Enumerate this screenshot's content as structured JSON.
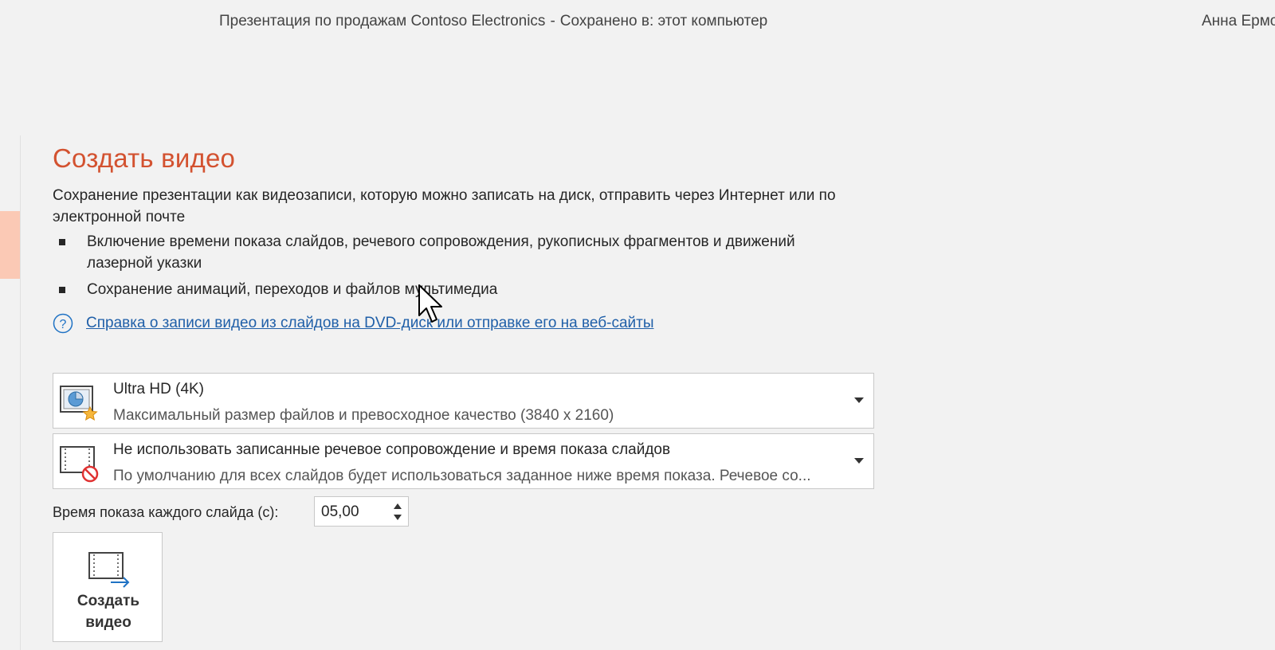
{
  "window": {
    "doc_name": "Презентация по продажам Contoso Electronics",
    "separator": "-",
    "save_status": "Сохранено в: этот компьютер",
    "user_name": "Анна Ермо"
  },
  "main": {
    "heading": "Создать видео",
    "description": "Сохранение презентации как видеозаписи, которую можно записать на диск, отправить через Интернет или по электронной почте",
    "bullets": [
      "Включение времени показа слайдов, речевого сопровождения, рукописных фрагментов и движений лазерной указки",
      "Сохранение анимаций, переходов и файлов мультимедиа"
    ],
    "help_link": "Справка о записи видео из слайдов на DVD-диск или отправке его на веб-сайты"
  },
  "quality_dropdown": {
    "title": "Ultra HD (4K)",
    "subtitle": "Максимальный размер файлов и превосходное качество (3840 x 2160)",
    "icon": "presentation-quality-star-icon"
  },
  "narration_dropdown": {
    "title": "Не использовать записанные речевое сопровождение и время показа слайдов",
    "subtitle": "По умолчанию для всех слайдов будет использоваться заданное ниже время показа. Речевое со...",
    "icon": "filmstrip-no-icon"
  },
  "slide_time": {
    "label": "Время показа каждого слайда (с):",
    "value": "05,00"
  },
  "create_button": {
    "label": "Создать\nвидео",
    "icon": "filmstrip-export-icon"
  },
  "colors": {
    "heading": "#d35230",
    "link": "#1f5fa8",
    "rail_highlight": "#fbc9b5"
  }
}
